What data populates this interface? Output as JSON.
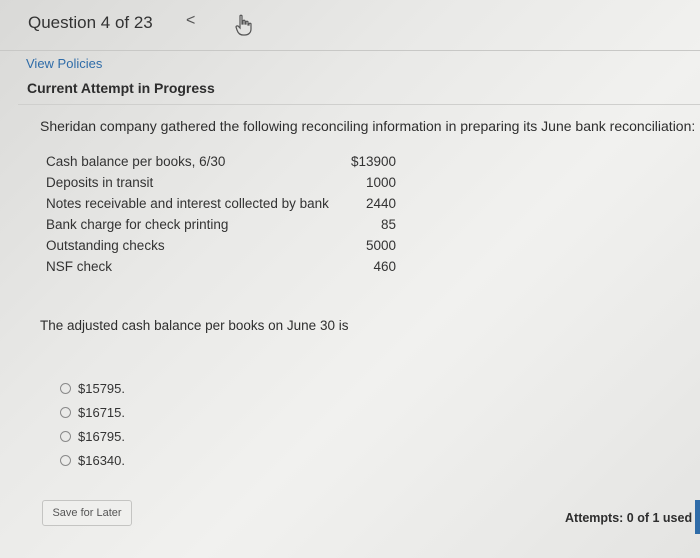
{
  "header": {
    "question_label": "Question 4 of 23",
    "prev_glyph": "<"
  },
  "links": {
    "view_policies": "View Policies"
  },
  "status": {
    "current_attempt": "Current Attempt in Progress"
  },
  "problem": {
    "prompt": "Sheridan company gathered the following reconciling information in preparing its June bank reconciliation:",
    "items": [
      {
        "label": "Cash balance per books, 6/30",
        "value": "$13900"
      },
      {
        "label": "Deposits in transit",
        "value": "1000"
      },
      {
        "label": "Notes receivable and interest collected by bank",
        "value": "2440"
      },
      {
        "label": "Bank charge for check printing",
        "value": "85"
      },
      {
        "label": "Outstanding checks",
        "value": "5000"
      },
      {
        "label": "NSF check",
        "value": "460"
      }
    ],
    "question": "The adjusted cash balance per books on June 30 is",
    "options": [
      "$15795.",
      "$16715.",
      "$16795.",
      "$16340."
    ]
  },
  "footer": {
    "save_label": "Save for Later",
    "attempts": "Attempts: 0 of 1 used"
  },
  "colors": {
    "link": "#2f6ca8",
    "accent": "#2f6ca8"
  },
  "icons": {
    "prev": "chevron-left-icon",
    "hint": "pointing-hand-icon"
  }
}
